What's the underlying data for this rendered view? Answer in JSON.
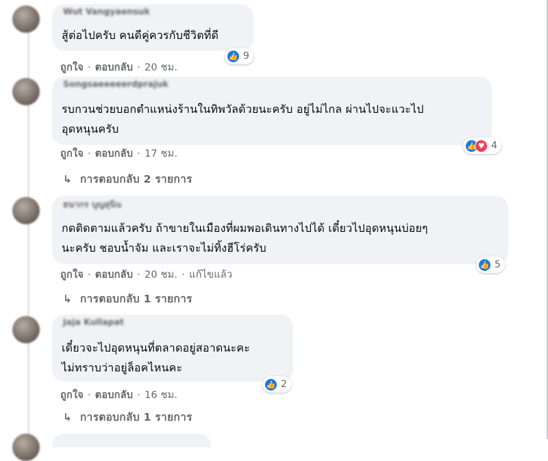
{
  "comments": [
    {
      "author": "Wut Vangyaensuk",
      "text_lines": [
        "สู้ต่อไปครับ คนดีคู่ควรกับชีวิตที่ดี"
      ],
      "reactions": {
        "count": "9",
        "types": [
          "like"
        ]
      },
      "actions": {
        "like": "ถูกใจ",
        "reply": "ตอบกลับ",
        "time": "20 ชม.",
        "edited": ""
      },
      "replies": ""
    },
    {
      "author": "Songsaeeeeerdprajuk",
      "text_lines": [
        "รบกวนช่วยบอกตำแหน่งร้านในทิพวัลด้วยนะครับ อยู่ไม่ไกล ผ่านไปจะแวะไป",
        "อุดหนุนครับ"
      ],
      "reactions": {
        "count": "4",
        "types": [
          "like",
          "love"
        ]
      },
      "actions": {
        "like": "ถูกใจ",
        "reply": "ตอบกลับ",
        "time": "17 ชม.",
        "edited": ""
      },
      "replies": "การตอบกลับ 2 รายการ"
    },
    {
      "author": "ธนากร บุญสุนิน",
      "text_lines": [
        "กดติดตามแล้วครับ ถ้าขายในเมืองที่ผมพอเดินทางไปได้ เดี๋ยวไปอุดหนุนบ่อยๆ",
        "นะครับ ชอบน้ำจัม และเราจะไม่ทิ้งฮีโร่ครับ"
      ],
      "reactions": {
        "count": "5",
        "types": [
          "like"
        ]
      },
      "actions": {
        "like": "ถูกใจ",
        "reply": "ตอบกลับ",
        "time": "20 ชม.",
        "edited": "แก้ไขแล้ว"
      },
      "replies": "การตอบกลับ 1 รายการ"
    },
    {
      "author": "Jaja Kullapat",
      "text_lines": [
        "เดี๋ยวจะไปอุดหนุนที่ตลาดอยู่สอาดนะคะ",
        "ไม่ทราบว่าอยู่ล็อคไหนคะ"
      ],
      "reactions": {
        "count": "2",
        "types": [
          "like"
        ]
      },
      "actions": {
        "like": "ถูกใจ",
        "reply": "ตอบกลับ",
        "time": "16 ชม.",
        "edited": ""
      },
      "replies": "การตอบกลับ 1 รายการ"
    }
  ],
  "reply_arrow": "↳",
  "separator": "·",
  "colors": {
    "bubble": "#f0f2f5",
    "meta_text": "#65676b",
    "like_blue": "#1877f2",
    "love_red": "#f33e58"
  }
}
